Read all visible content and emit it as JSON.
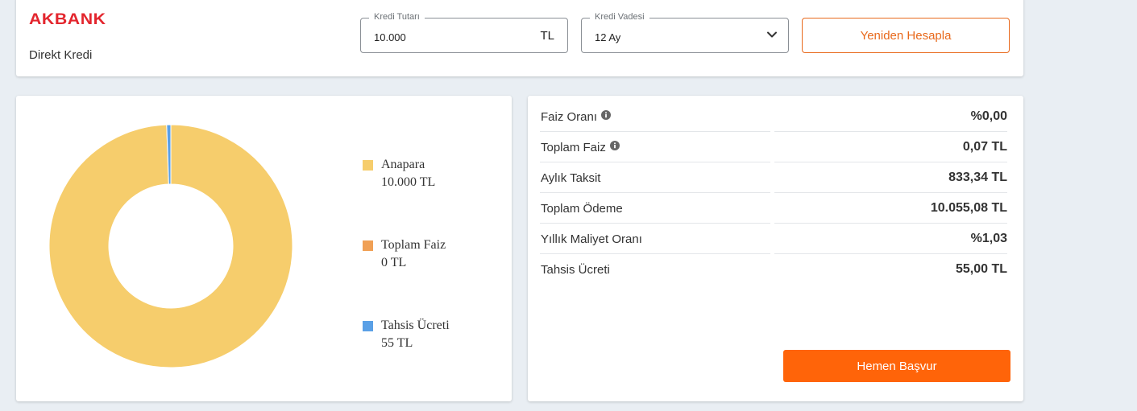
{
  "header": {
    "logo_text": "AKBANK",
    "product_name": "Direkt Kredi",
    "amount_field": {
      "label": "Kredi Tutarı",
      "value": "10.000",
      "unit": "TL"
    },
    "term_field": {
      "label": "Kredi Vadesi",
      "value": "12 Ay"
    },
    "recalculate_label": "Yeniden Hesapla"
  },
  "colors": {
    "brand_red": "#e3262e",
    "accent_orange": "#ff6409",
    "principal": "#f6cd6c",
    "interest": "#f0a055",
    "fee": "#5aa0e6"
  },
  "legend": [
    {
      "name": "Anapara",
      "value": "10.000 TL"
    },
    {
      "name": "Toplam Faiz",
      "value": "0 TL"
    },
    {
      "name": "Tahsis Ücreti",
      "value": "55 TL"
    }
  ],
  "chart_data": {
    "type": "pie",
    "categories": [
      "Anapara",
      "Toplam Faiz",
      "Tahsis Ücreti"
    ],
    "values": [
      10000,
      0.07,
      55
    ],
    "donut": true,
    "legend": "right"
  },
  "summary": {
    "rows": [
      {
        "label": "Faiz Oranı",
        "value": "%0,00",
        "info_icon": true
      },
      {
        "label": "Toplam Faiz",
        "value": "0,07 TL",
        "info_icon": true
      },
      {
        "label": "Aylık Taksit",
        "value": "833,34 TL",
        "info_icon": false
      },
      {
        "label": "Toplam Ödeme",
        "value": "10.055,08 TL",
        "info_icon": false
      },
      {
        "label": "Yıllık Maliyet Oranı",
        "value": "%1,03",
        "info_icon": false
      },
      {
        "label": "Tahsis Ücreti",
        "value": "55,00 TL",
        "info_icon": false
      }
    ],
    "apply_label": "Hemen Başvur"
  }
}
